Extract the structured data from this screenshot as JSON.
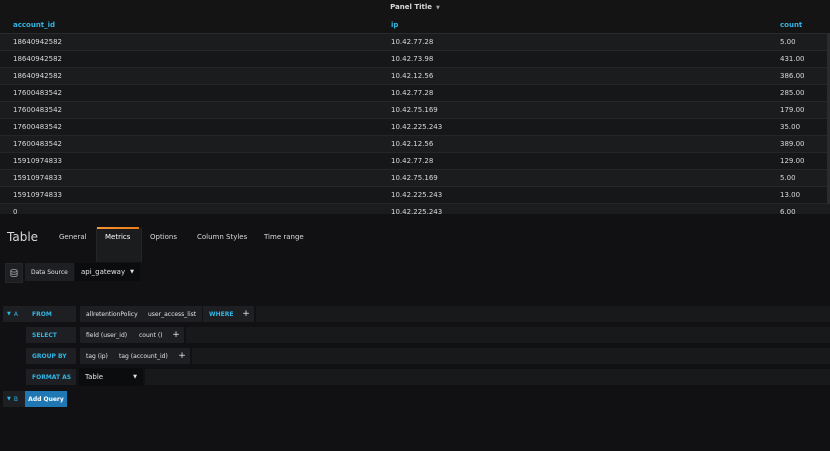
{
  "panel": {
    "title": "Panel Title",
    "columns": [
      "account_id",
      "ip",
      "count"
    ],
    "rows": [
      [
        "18640942582",
        "10.42.77.28",
        "5.00"
      ],
      [
        "18640942582",
        "10.42.73.98",
        "431.00"
      ],
      [
        "18640942582",
        "10.42.12.56",
        "386.00"
      ],
      [
        "17600483542",
        "10.42.77.28",
        "285.00"
      ],
      [
        "17600483542",
        "10.42.75.169",
        "179.00"
      ],
      [
        "17600483542",
        "10.42.225.243",
        "35.00"
      ],
      [
        "17600483542",
        "10.42.12.56",
        "389.00"
      ],
      [
        "15910974833",
        "10.42.77.28",
        "129.00"
      ],
      [
        "15910974833",
        "10.42.75.169",
        "5.00"
      ],
      [
        "15910974833",
        "10.42.225.243",
        "13.00"
      ],
      [
        "0",
        "10.42.225.243",
        "6.00"
      ]
    ]
  },
  "editor": {
    "title": "Table",
    "tabs": [
      {
        "label": "General"
      },
      {
        "label": "Metrics",
        "active": true
      },
      {
        "label": "Options"
      },
      {
        "label": "Column Styles"
      },
      {
        "label": "Time range"
      }
    ]
  },
  "datasource": {
    "label": "Data Source",
    "value": "api_gateway"
  },
  "query": {
    "ref_a": "A",
    "ref_b": "B",
    "from_kw": "FROM",
    "policy": "allretentionPolicy",
    "measurement": "user_access_list",
    "where_kw": "WHERE",
    "select_kw": "SELECT",
    "select_field": "field (user_id)",
    "select_fn": "count ()",
    "groupby_kw": "GROUP BY",
    "group_tag_1": "tag (ip)",
    "group_tag_2": "tag (account_id)",
    "format_kw": "FORMAT AS",
    "format_value": "Table",
    "add_query_label": "Add Query"
  },
  "colors": {
    "accent_blue": "#33b5e5",
    "tab_active_orange": "#eb7b18",
    "add_query_button": "#1f78b4",
    "background": "#161719"
  }
}
